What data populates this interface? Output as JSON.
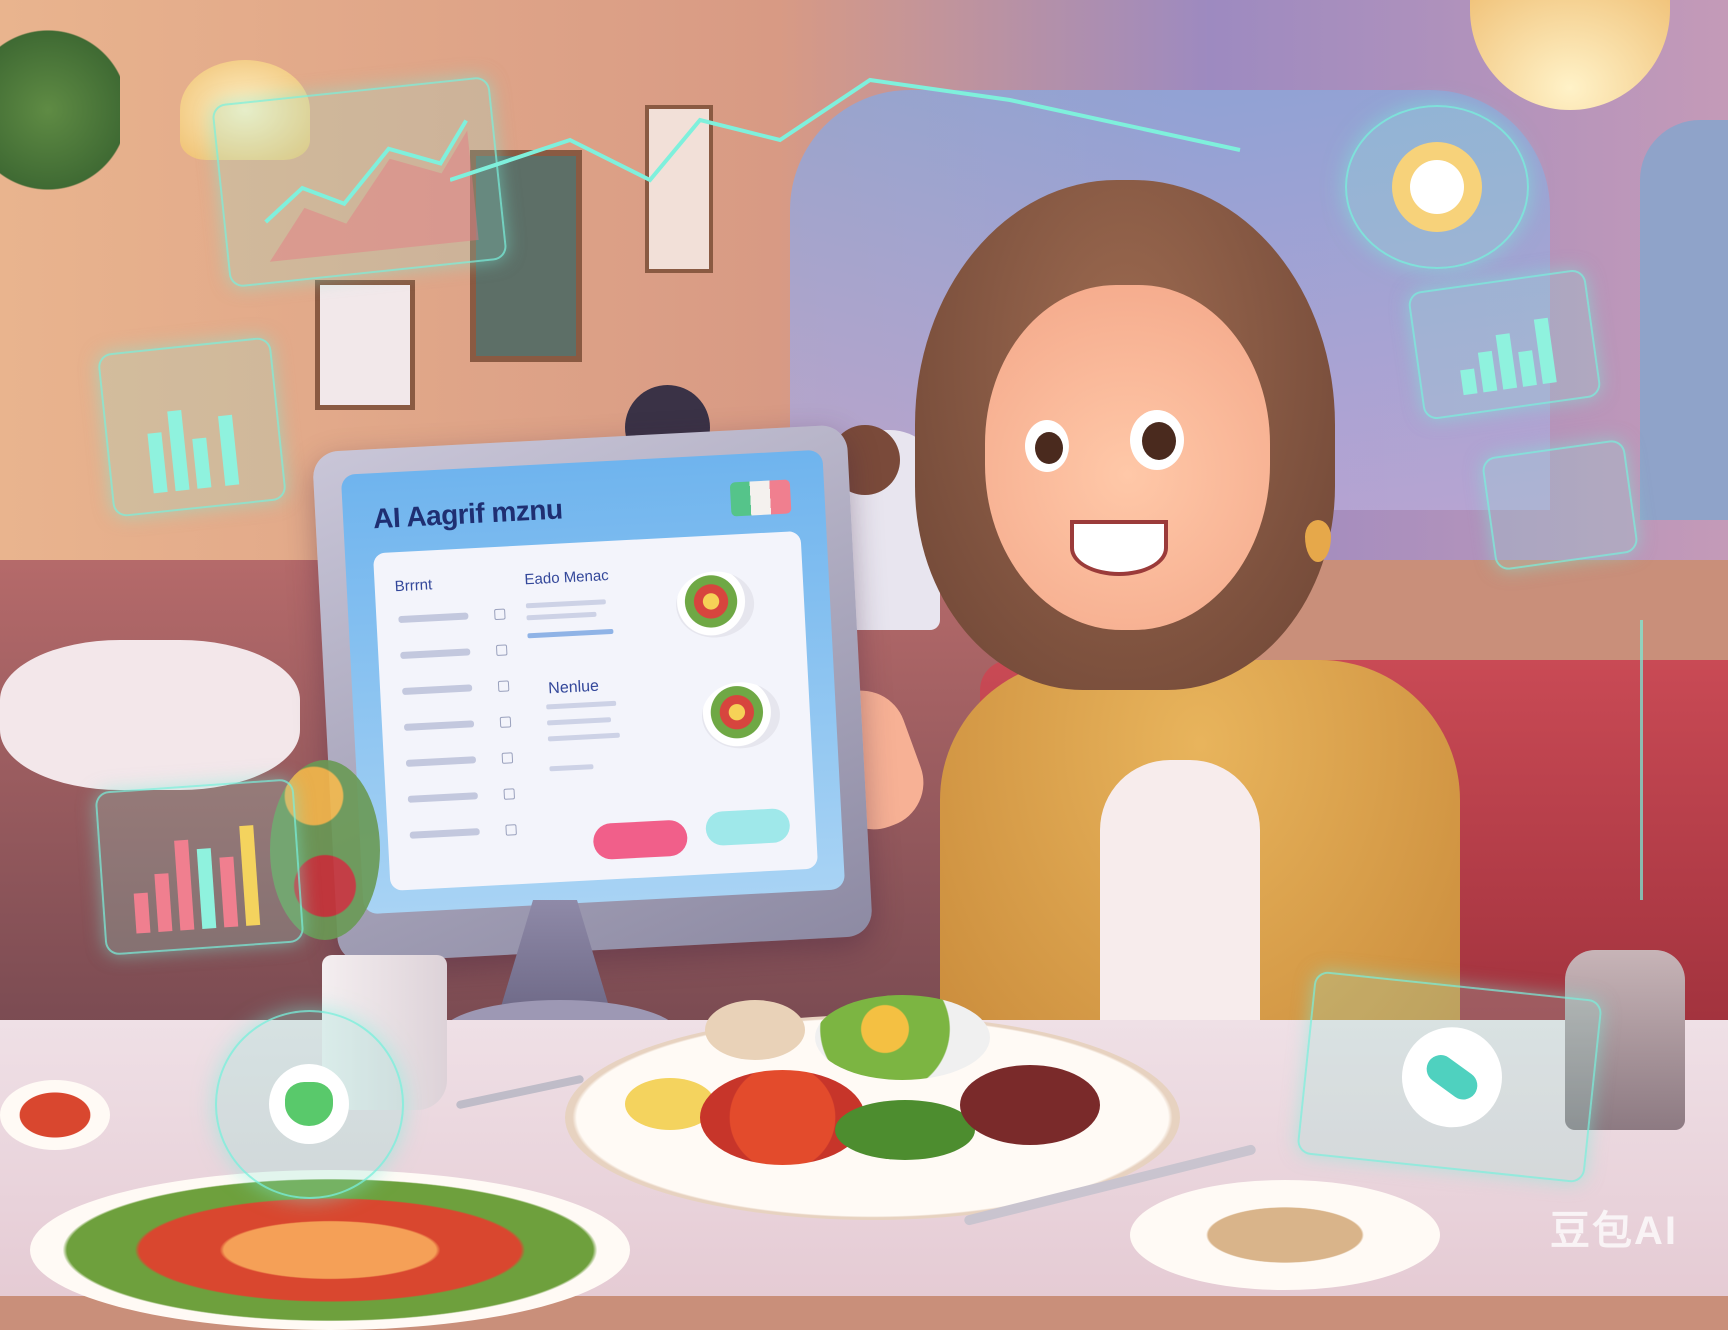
{
  "screen": {
    "title": "AI Aagrif mznu",
    "left_heading": "Brrrnt",
    "right_heading": "Eado Menac",
    "sub_heading": "Nenlue"
  },
  "icons": [
    "line-chart-icon",
    "bar-chart-icon",
    "heart-icon",
    "checkmark-target-icon",
    "capsule-icon"
  ],
  "colors": {
    "holo": "#78f0dc",
    "screen_blue": "#6fb4ee",
    "button_pink": "#f15f8a",
    "button_teal": "#9fe8ea",
    "booth_red": "#c94a55"
  },
  "watermark": "豆包AI"
}
